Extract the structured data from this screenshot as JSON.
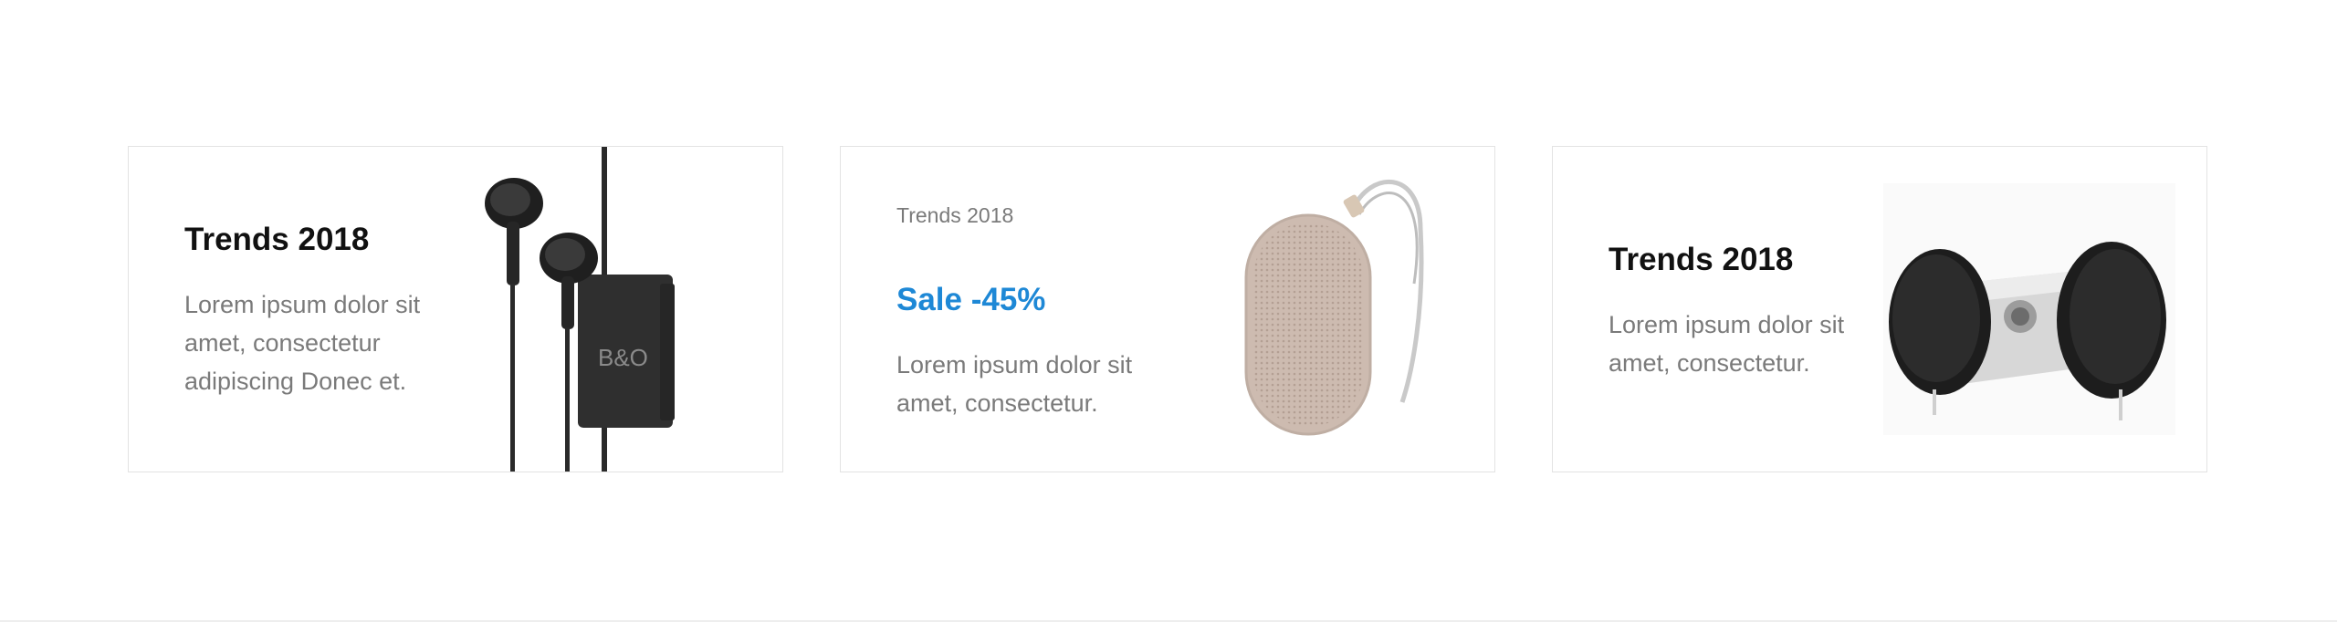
{
  "cards": [
    {
      "title": "Trends 2018",
      "description": "Lorem ipsum dolor sit amet, consectetur adipiscing Donec et.",
      "image": "earphones-image",
      "image_brand": "B&O"
    },
    {
      "eyebrow": "Trends 2018",
      "sale": "Sale -45%",
      "description": "Lorem ipsum dolor sit amet, consectetur.",
      "image": "portable-speaker-image"
    },
    {
      "title": "Trends 2018",
      "description": "Lorem ipsum dolor sit amet, consectetur.",
      "image": "speaker-dock-image"
    }
  ],
  "colors": {
    "accent": "#1e88d6",
    "border": "#e3e3e3",
    "text_muted": "#7a7a7a"
  }
}
